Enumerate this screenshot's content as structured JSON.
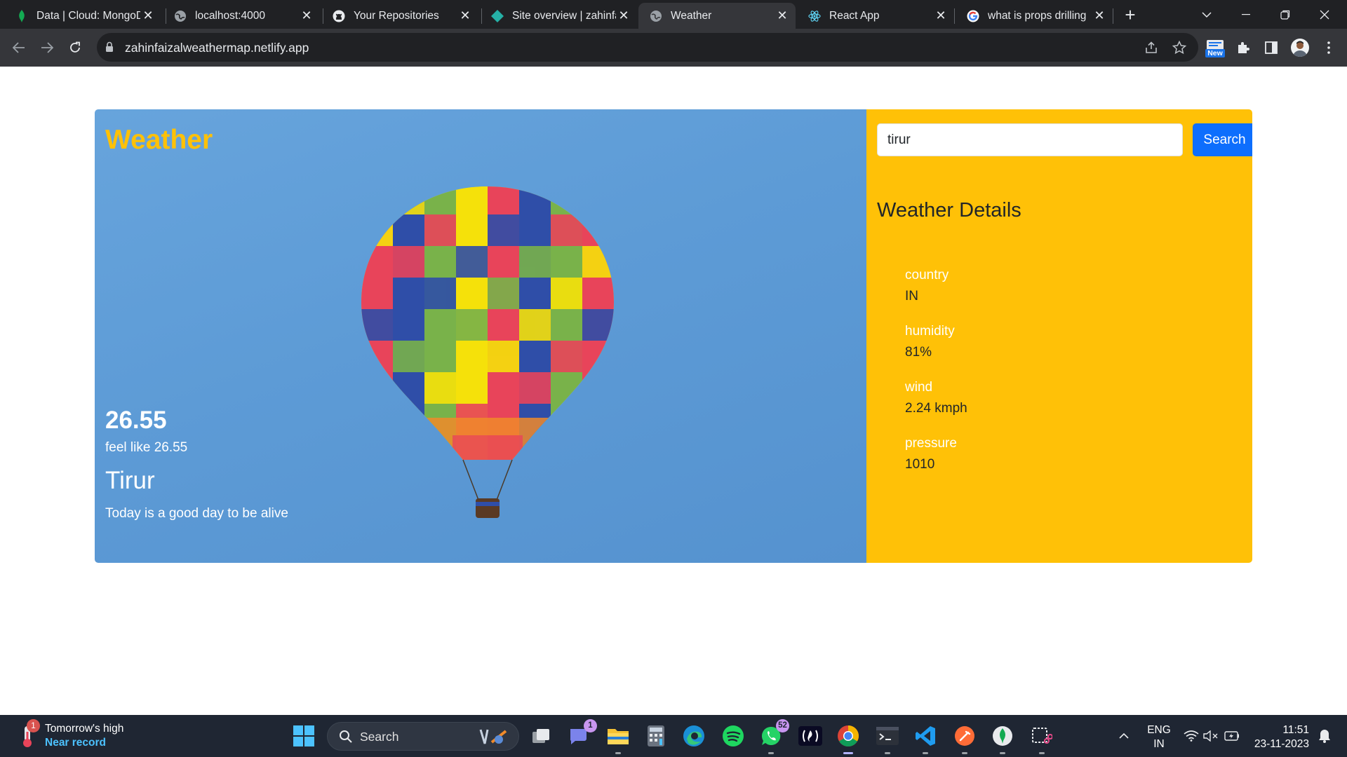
{
  "browser": {
    "tabs": [
      {
        "title": "Data | Cloud: MongoDB",
        "favicon": "mongodb-leaf-icon",
        "active": false
      },
      {
        "title": "localhost:4000",
        "favicon": "globe-icon",
        "active": false
      },
      {
        "title": "Your Repositories",
        "favicon": "github-icon",
        "active": false
      },
      {
        "title": "Site overview | zahinfaizal",
        "favicon": "netlify-icon",
        "active": false
      },
      {
        "title": "Weather",
        "favicon": "globe-icon",
        "active": true
      },
      {
        "title": "React App",
        "favicon": "react-icon",
        "active": false
      },
      {
        "title": "what is props drilling",
        "favicon": "google-icon",
        "active": false
      }
    ],
    "url": "zahinfaizalweathermap.netlify.app",
    "extension_badge": "New"
  },
  "app": {
    "brand": "Weather",
    "temperature": "26.55",
    "feels_like": "feel like 26.55",
    "city": "Tirur",
    "tagline": "Today is a good day to be alive",
    "search": {
      "value": "tirur",
      "button": "Search"
    },
    "details_title": "Weather Details",
    "details": [
      {
        "label": "country",
        "value": "IN"
      },
      {
        "label": "humidity",
        "value": "81%"
      },
      {
        "label": "wind",
        "value": "2.24 kmph"
      },
      {
        "label": "pressure",
        "value": "1010"
      }
    ],
    "colors": {
      "accent": "#ffc107",
      "sky": "#5d9bd6",
      "button": "#0d6efd"
    }
  },
  "taskbar": {
    "weather_widget": {
      "line1": "Tomorrow's high",
      "line2": "Near record",
      "badge": "1"
    },
    "search_label": "Search",
    "teams_badge": "1",
    "whatsapp_badge": "52",
    "language": {
      "line1": "ENG",
      "line2": "IN"
    },
    "clock": {
      "time": "11:51",
      "date": "23-11-2023"
    }
  }
}
